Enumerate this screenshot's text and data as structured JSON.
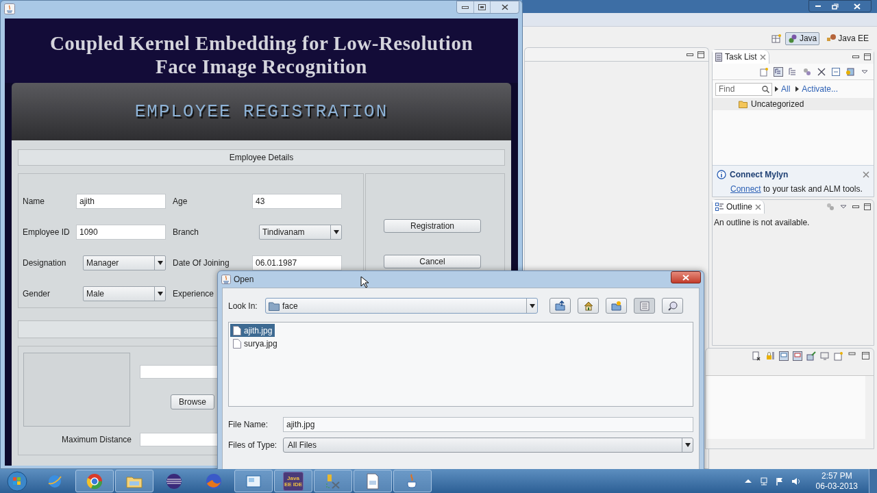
{
  "app_window": {
    "heading_lines": [
      "Coupled Kernel Embedding for Low-Resolution",
      "Face Image Recognition"
    ],
    "banner": "EMPLOYEE REGISTRATION",
    "section_title": "Employee Details",
    "rows": [
      {
        "left": {
          "label": "Name",
          "kind": "text",
          "value": "ajith"
        },
        "right": {
          "label": "Age",
          "kind": "text",
          "value": "43"
        }
      },
      {
        "left": {
          "label": "Employee ID",
          "kind": "text",
          "value": "1090"
        },
        "right": {
          "label": "Branch",
          "kind": "combo",
          "value": "Tindivanam"
        }
      },
      {
        "left": {
          "label": "Designation",
          "kind": "combo",
          "value": "Manager"
        },
        "right": {
          "label": "Date Of Joining",
          "kind": "text",
          "value": "06.01.1987"
        }
      },
      {
        "left": {
          "label": "Gender",
          "kind": "combo",
          "value": "Male"
        },
        "right": {
          "label": "Experience",
          "kind": "none"
        }
      }
    ],
    "actions": [
      "Registration",
      "Cancel"
    ],
    "browse_button": "Browse",
    "distance_label": "Maximum Distance"
  },
  "ide": {
    "perspectives": [
      {
        "label": "Java",
        "selected": true
      },
      {
        "label": "Java EE",
        "selected": false
      }
    ],
    "task_list": {
      "title": "Task List",
      "find_placeholder": "Find",
      "filters": [
        "All",
        "Activate..."
      ],
      "categories": [
        "Uncategorized"
      ]
    },
    "mylyn": {
      "title": "Connect Mylyn",
      "link": "Connect",
      "text": "to your task and ALM tools."
    },
    "outline": {
      "title": "Outline",
      "message": "An outline is not available."
    }
  },
  "open_dialog": {
    "title": "Open",
    "look_in_label": "Look In:",
    "look_in": "face",
    "files": [
      {
        "name": "ajith.jpg",
        "selected": true
      },
      {
        "name": "surya.jpg",
        "selected": false
      }
    ],
    "file_name_label": "File Name:",
    "file_name": "ajith.jpg",
    "type_label": "Files of Type:",
    "type": "All Files"
  },
  "taskbar": {
    "badge_text": "Java EE IDE",
    "time": "2:57 PM",
    "date": "06-03-2013"
  }
}
